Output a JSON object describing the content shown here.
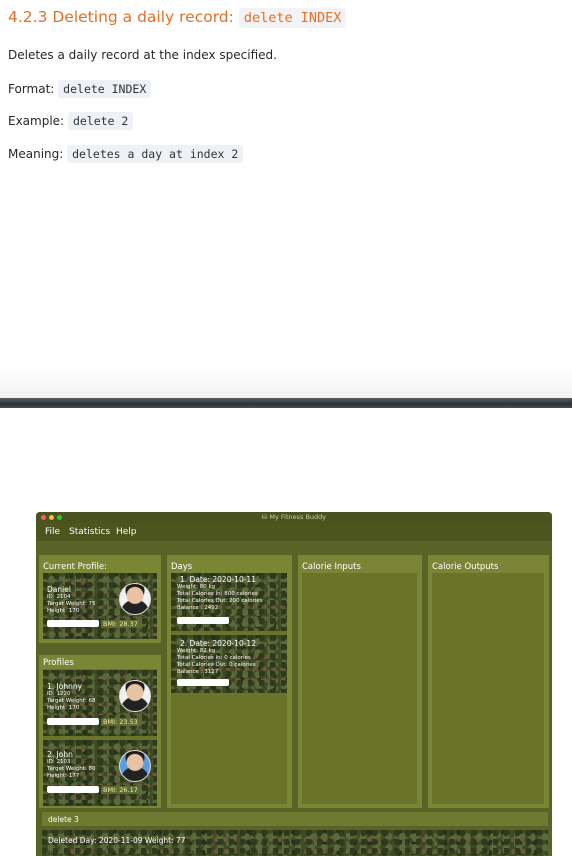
{
  "doc": {
    "heading_prefix": "4.2.3 Deleting a daily record:",
    "heading_code": "delete INDEX",
    "description": "Deletes a daily record at the index specified.",
    "format_label": "Format:",
    "format_code": "delete INDEX",
    "example_label": "Example:",
    "example_code": "delete 2",
    "meaning_label": "Meaning:",
    "meaning_code": "deletes a day at index 2"
  },
  "app": {
    "window_title": "My Fitness Buddy",
    "menu": [
      "File",
      "Statistics",
      "Help"
    ],
    "current_profile": {
      "title": "Current Profile:",
      "name": "Daniel",
      "id": "ID: 2104",
      "target_weight": "Target Weight: 75",
      "height": "Height: 170",
      "bmi": "BMI: 28.37"
    },
    "profiles": {
      "title": "Profiles",
      "items": [
        {
          "name": "1.  Johnny",
          "id": "ID: 1220",
          "target_weight": "Target Weight: 68",
          "height": "Height: 170",
          "bmi": "BMI: 23.53"
        },
        {
          "name": "2.  John",
          "id": "ID: 2103",
          "target_weight": "Target Weight: 80",
          "height": "Height: 177",
          "bmi": "BMI: 26.17"
        }
      ]
    },
    "days": {
      "title": "Days",
      "items": [
        {
          "date": "1.  Date: 2020-10-11",
          "weight": "Weight: 80 kg",
          "cal_in": "Total Calories In: 800 calories",
          "cal_out": "Total Calories Out: 200 calories",
          "balance": "Balance : 2492"
        },
        {
          "date": "2.  Date: 2020-10-12",
          "weight": "Weight: 82 kg",
          "cal_in": "Total Calories In: 0 calories",
          "cal_out": "Total Calories Out: 0 calories",
          "balance": "Balance : 3127"
        }
      ]
    },
    "calorie_inputs_title": "Calorie Inputs",
    "calorie_outputs_title": "Calorie Outputs",
    "command": "delete 3",
    "result": "Deleted Day: 2020-11-09 Weight: 77"
  }
}
